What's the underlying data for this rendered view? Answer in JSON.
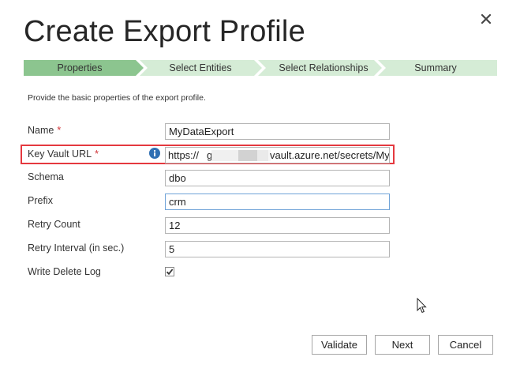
{
  "dialog": {
    "title": "Create Export Profile",
    "close_glyph": "✕"
  },
  "wizard": {
    "steps": [
      {
        "label": "Properties",
        "active": true
      },
      {
        "label": "Select Entities",
        "active": false
      },
      {
        "label": "Select Relationships",
        "active": false
      },
      {
        "label": "Summary",
        "active": false
      }
    ],
    "colors": {
      "active": "#8cc58f",
      "inactive": "#d5ecd6"
    }
  },
  "description": "Provide the basic properties of the export profile.",
  "form": {
    "required_mark": "*",
    "name": {
      "label": "Name",
      "value": "MyDataExport"
    },
    "key_vault_url": {
      "label": "Key Vault URL",
      "value_prefix": "https://",
      "value_partial": "g",
      "value_suffix": "vault.azure.net/secrets/My"
    },
    "schema": {
      "label": "Schema",
      "value": "dbo"
    },
    "prefix": {
      "label": "Prefix",
      "value": "crm"
    },
    "retry_count": {
      "label": "Retry Count",
      "value": "12"
    },
    "retry_interval": {
      "label": "Retry Interval (in sec.)",
      "value": "5"
    },
    "write_delete_log": {
      "label": "Write Delete Log",
      "checked": true
    }
  },
  "buttons": {
    "validate": "Validate",
    "next": "Next",
    "cancel": "Cancel"
  },
  "colors": {
    "highlight": "#e5393f",
    "required": "#d13438",
    "info_icon": "#2f6fb3",
    "focus_border": "#6fa3d8"
  }
}
